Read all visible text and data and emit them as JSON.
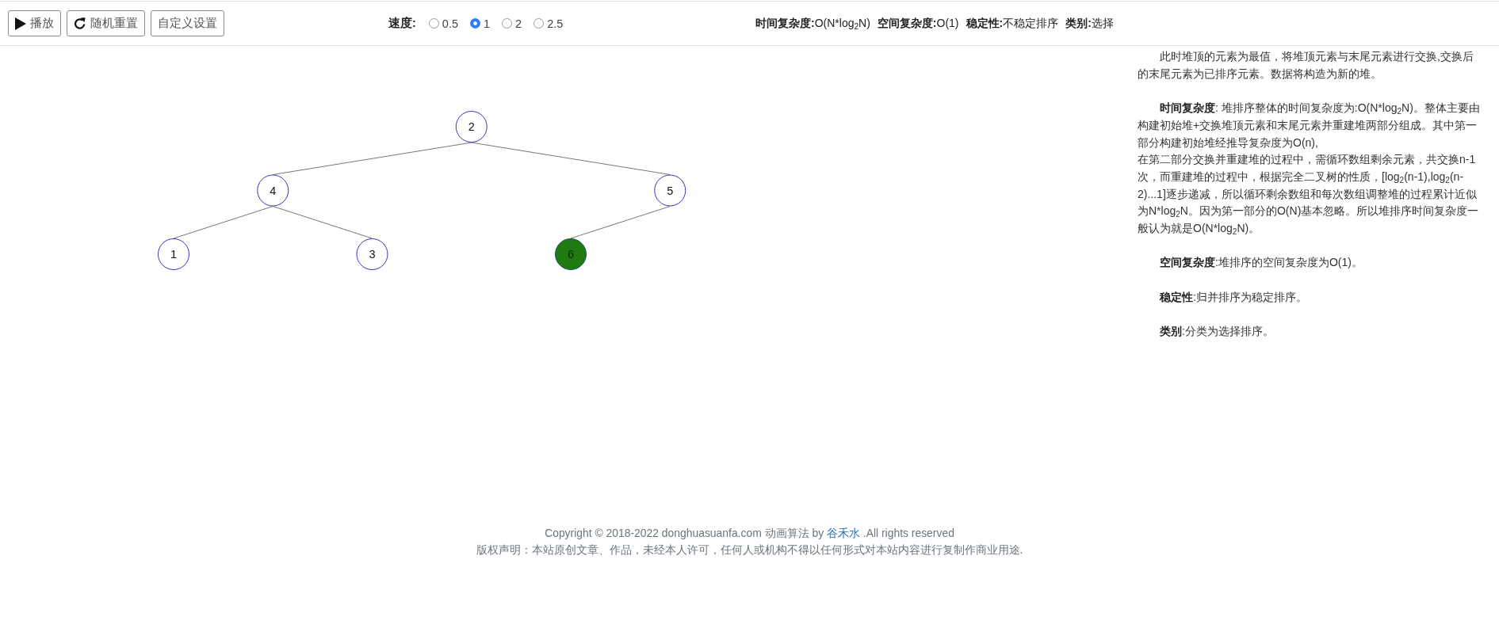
{
  "toolbar": {
    "buttons": [
      {
        "kind": "play",
        "label": "播放"
      },
      {
        "kind": "reset",
        "label": "随机重置"
      },
      {
        "kind": "custom",
        "label": "自定义设置"
      }
    ]
  },
  "speed": {
    "label": "速度:",
    "options": [
      {
        "label": "0.5",
        "selected": false
      },
      {
        "label": "1",
        "selected": true
      },
      {
        "label": "2",
        "selected": false
      },
      {
        "label": "2.5",
        "selected": false
      }
    ]
  },
  "complexity_summary": [
    "**时间复杂度:**O(N*log$_{2}$N)",
    "**空间复杂度:**O(1)",
    "**稳定性:**不稳定排序",
    "**类别:**选择"
  ],
  "heap_tree": {
    "root": {
      "value": "2",
      "sorted": false,
      "children": [
        {
          "value": "4",
          "sorted": false,
          "children": [
            {
              "value": "1",
              "sorted": false
            },
            {
              "value": "3",
              "sorted": false
            }
          ]
        },
        {
          "value": "5",
          "sorted": false,
          "children": [
            {
              "value": "6",
              "sorted": true
            }
          ]
        }
      ]
    }
  },
  "explanation": [
    "此时堆顶的元素为最值，将堆顶元素与末尾元素进行交换,交换后的末尾元素为已排序元素。数据将构造为新的堆。",
    "**时间复杂度**: 堆排序整体的时间复杂度为:O(N*log$_{2}$N)。整体主要由构建初始堆+交换堆顶元素和末尾元素并重建堆两部分组成。其中第一部分构建初始堆经推导复杂度为O(n),\n在第二部分交换并重建堆的过程中，需循环数组剩余元素，共交换n-1次，而重建堆的过程中，根据完全二叉树的性质，[log$_{2}$(n-1),log$_{2}$(n-2)...1]逐步递减，所以循环剩余数组和每次数组调整堆的过程累计近似为N*log$_{2}$N。因为第一部分的O(N)基本忽略。所以堆排序时间复杂度一般认为就是O(N*log$_{2}$N)。",
    "**空间复杂度**:堆排序的空间复杂度为O(1)。",
    "**稳定性**:归并排序为稳定排序。",
    "**类别**:分类为选择排序。"
  ],
  "footer": {
    "copyright_prefix": "Copyright © 2018-2022 donghuasuanfa.com 动画算法 by",
    "author_link": "谷禾水",
    "copyright_suffix": ".All rights reserved",
    "notice": "版权声明：本站原创文章、作品，未经本人许可，任何人或机构不得以任何形式对本站内容进行复制作商业用途."
  }
}
